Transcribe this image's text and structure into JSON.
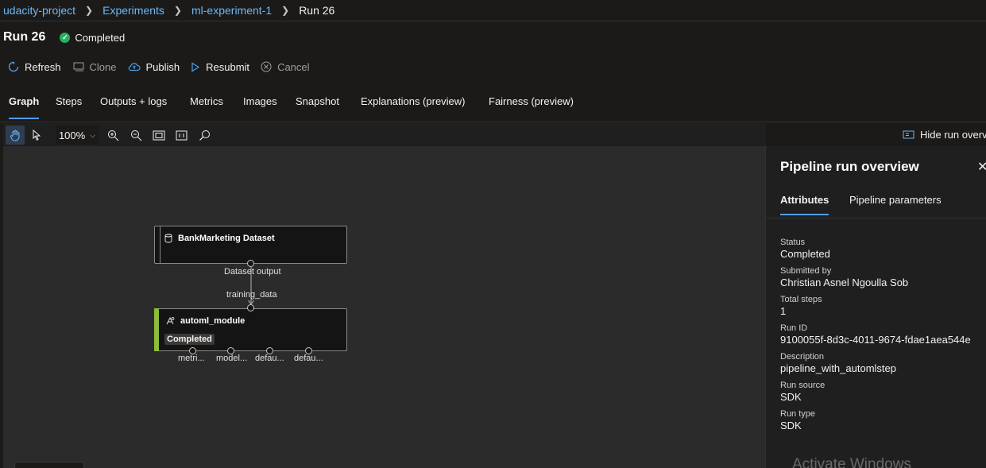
{
  "breadcrumb": {
    "items": [
      "udacity-project",
      "Experiments",
      "ml-experiment-1"
    ],
    "current": "Run 26"
  },
  "run": {
    "title": "Run 26",
    "status": "Completed"
  },
  "commands": {
    "refresh": "Refresh",
    "clone": "Clone",
    "publish": "Publish",
    "resubmit": "Resubmit",
    "cancel": "Cancel"
  },
  "tabs": [
    "Graph",
    "Steps",
    "Outputs + logs",
    "Metrics",
    "Images",
    "Snapshot",
    "Explanations (preview)",
    "Fairness (preview)"
  ],
  "toolbar": {
    "zoom": "100%",
    "hide_overview": "Hide run overv"
  },
  "graph": {
    "dataset_node": {
      "title": "BankMarketing Dataset",
      "output_port": "Dataset output"
    },
    "automl_node": {
      "title": "automl_module",
      "status": "Completed",
      "input_port": "training_data",
      "outputs": [
        "metri...",
        "model...",
        "defau...",
        "defau..."
      ]
    }
  },
  "panel": {
    "title": "Pipeline run overview",
    "close_icon": "close-icon",
    "tabs": [
      "Attributes",
      "Pipeline parameters"
    ],
    "attributes": [
      {
        "label": "Status",
        "value": "Completed"
      },
      {
        "label": "Submitted by",
        "value": "Christian Asnel Ngoulla Sob"
      },
      {
        "label": "Total steps",
        "value": "1"
      },
      {
        "label": "Run ID",
        "value": "9100055f-8d3c-4011-9674-fdae1aea544e"
      },
      {
        "label": "Description",
        "value": "pipeline_with_automlstep"
      },
      {
        "label": "Run source",
        "value": "SDK"
      },
      {
        "label": "Run type",
        "value": "SDK"
      }
    ]
  },
  "watermark": "Activate Windows",
  "colors": {
    "accent": "#4f9ee8",
    "success": "#27ae60",
    "link": "#6cb8f6",
    "module_bar": "#8cbd3a"
  }
}
